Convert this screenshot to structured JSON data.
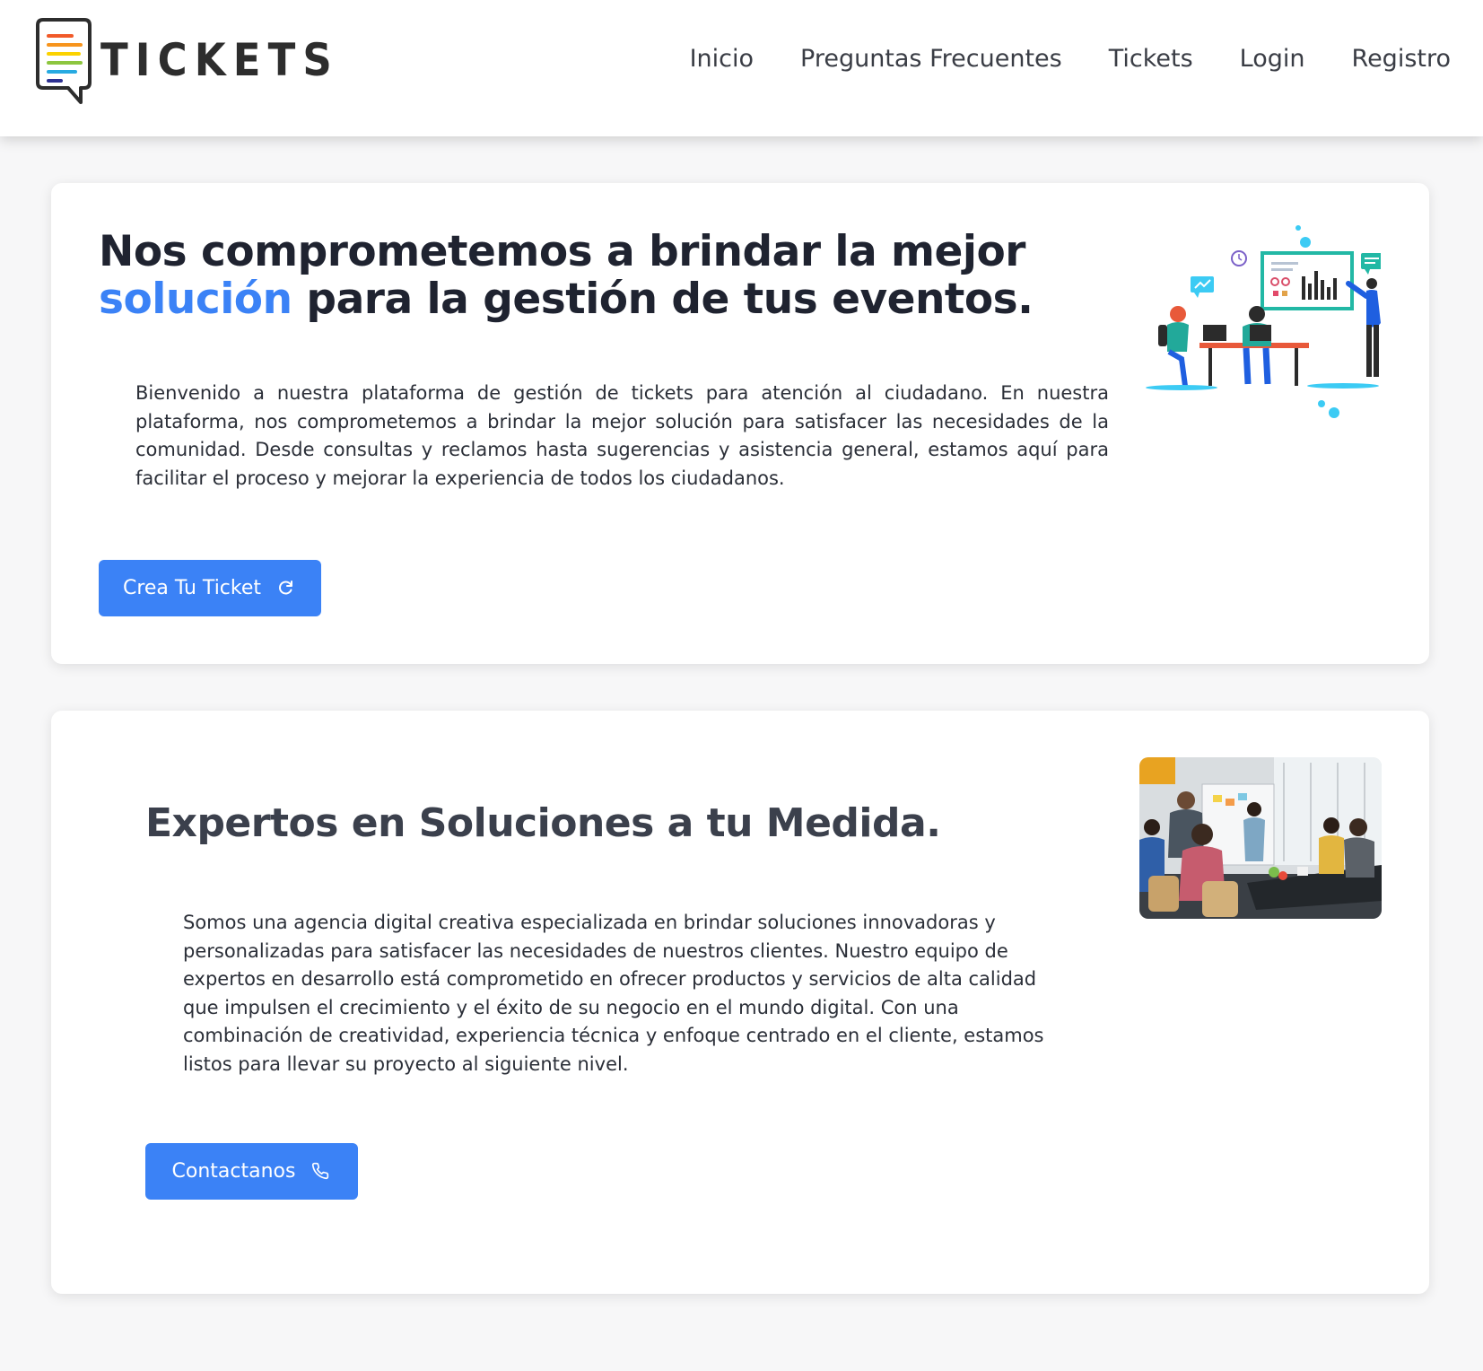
{
  "brand": {
    "name": "TICKETS",
    "logo_icon": "chat-bubble-lines-icon"
  },
  "nav": {
    "items": [
      {
        "label": "Inicio"
      },
      {
        "label": "Preguntas Frecuentes"
      },
      {
        "label": "Tickets"
      },
      {
        "label": "Login"
      },
      {
        "label": "Registro"
      }
    ]
  },
  "hero": {
    "title_part1": "Nos comprometemos a brindar la mejor",
    "title_accent": "solución",
    "title_part2": " para la gestión de tus eventos.",
    "paragraph": "Bienvenido a nuestra plataforma de gestión de tickets para atención al ciudadano. En nuestra plataforma, nos comprometemos a brindar la mejor solución para satisfacer las necesidades de la comunidad. Desde consultas y reclamos hasta sugerencias y asistencia general, estamos aquí para facilitar el proceso y mejorar la experiencia de todos los ciudadanos.",
    "button_label": "Crea Tu Ticket",
    "button_icon": "refresh-icon",
    "illustration": "team-meeting-illustration"
  },
  "experts": {
    "title": "Expertos en Soluciones a tu Medida.",
    "paragraph": "Somos una agencia digital creativa especializada en brindar soluciones innovadoras y personalizadas para satisfacer las necesidades de nuestros clientes. Nuestro equipo de expertos en desarrollo está comprometido en ofrecer productos y servicios de alta calidad que impulsen el crecimiento y el éxito de su negocio en el mundo digital. Con una combinación de creatividad, experiencia técnica y enfoque centrado en el cliente, estamos listos para llevar su proyecto al siguiente nivel.",
    "button_label": "Contactanos",
    "button_icon": "phone-icon",
    "photo": "office-team-photo"
  },
  "colors": {
    "accent": "#3b82f6",
    "title_dark": "#1f2330",
    "section_title": "#3b404c",
    "page_bg": "#f7f7f8",
    "card_bg": "#ffffff"
  }
}
